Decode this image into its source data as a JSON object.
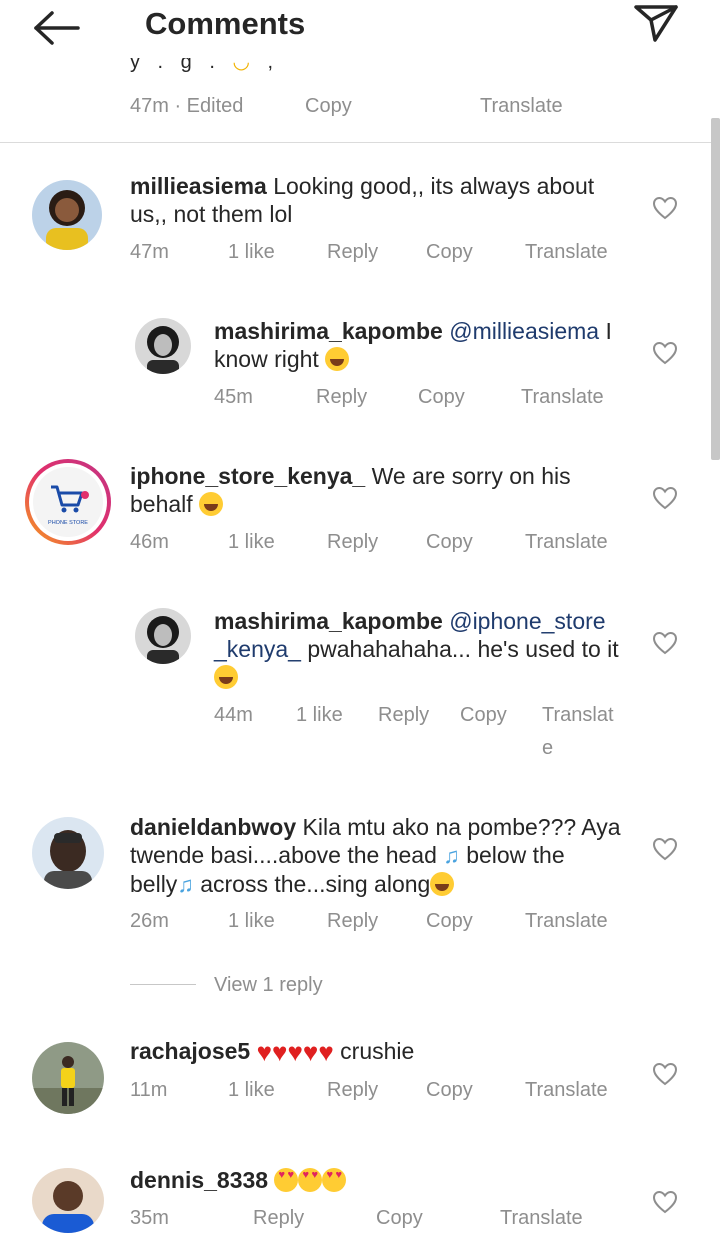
{
  "header": {
    "title": "Comments"
  },
  "top_partial": {
    "time": "47m · Edited",
    "copy": "Copy",
    "translate": "Translate"
  },
  "comments": [
    {
      "user": "millieasiema",
      "text": "Looking good,, its always about",
      "text2": "us,, not them lol",
      "time": "47m",
      "likes": "1 like",
      "reply": "Reply",
      "copy": "Copy",
      "translate": "Translate"
    },
    {
      "user": "mashirima_kapombe",
      "mention": "@millieasiema",
      "text_after": "I",
      "text2": "know right",
      "time": "45m",
      "reply": "Reply",
      "copy": "Copy",
      "translate": "Translate"
    },
    {
      "user": "iphone_store_kenya_",
      "text": "We are sorry on his",
      "text2": "behalf",
      "time": "46m",
      "likes": "1 like",
      "reply": "Reply",
      "copy": "Copy",
      "translate": "Translate",
      "avatar_text": "PHONE STORE"
    },
    {
      "user": "mashirima_kapombe",
      "mention": "@iphone_store",
      "mention2": "_kenya_",
      "text2": "pwahahahaha... he's used to it",
      "time": "44m",
      "likes": "1 like",
      "reply": "Reply",
      "copy": "Copy",
      "translate1": "Translat",
      "translate2": "e"
    },
    {
      "user": "danieldanbwoy",
      "text": "Kila mtu ako na pombe??? Aya",
      "text2a": "twende basi....above the head",
      "text2b": "below the",
      "text3a": "belly",
      "text3b": "across the...sing along",
      "time": "26m",
      "likes": "1 like",
      "reply": "Reply",
      "copy": "Copy",
      "translate": "Translate",
      "view_replies": "View 1 reply"
    },
    {
      "user": "rachajose5",
      "text": "crushie",
      "time": "11m",
      "likes": "1 like",
      "reply": "Reply",
      "copy": "Copy",
      "translate": "Translate"
    },
    {
      "user": "dennis_8338",
      "time": "35m",
      "reply": "Reply",
      "copy": "Copy",
      "translate": "Translate"
    }
  ],
  "icons": {
    "back": "back-arrow-icon",
    "send": "send-icon",
    "like": "heart-outline-icon"
  },
  "colors": {
    "text": "#262626",
    "meta": "#8e8e8e",
    "mention": "#1f3b6d",
    "divider": "#dbdbdb"
  }
}
